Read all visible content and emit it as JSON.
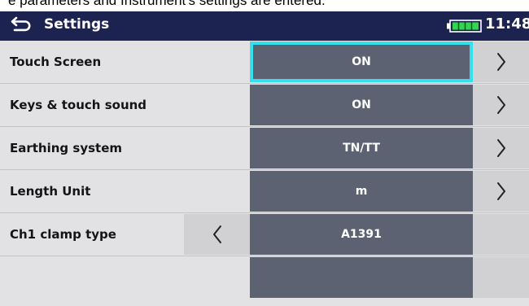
{
  "caption": "e parameters and Instrument's settings are entered.",
  "header": {
    "title": "Settings",
    "time": "11:48",
    "battery_level": 1.0
  },
  "settings": [
    {
      "label": "Touch Screen",
      "value": "ON"
    },
    {
      "label": "Keys & touch sound",
      "value": "ON"
    },
    {
      "label": "Earthing system",
      "value": "TN/TT"
    },
    {
      "label": "Length Unit",
      "value": "m"
    },
    {
      "label": "Ch1 clamp type",
      "value": "A1391"
    }
  ],
  "icons": {
    "back": "back-arrow-icon",
    "battery": "battery-icon",
    "next": "chevron-right-icon",
    "prev": "chevron-left-icon"
  },
  "colors": {
    "titlebar": "#1c2350",
    "value_bg": "#5d6272",
    "selection_border": "#33e0ee",
    "background": "#e2e2e4",
    "arrow_bg": "#d1d1d4"
  }
}
